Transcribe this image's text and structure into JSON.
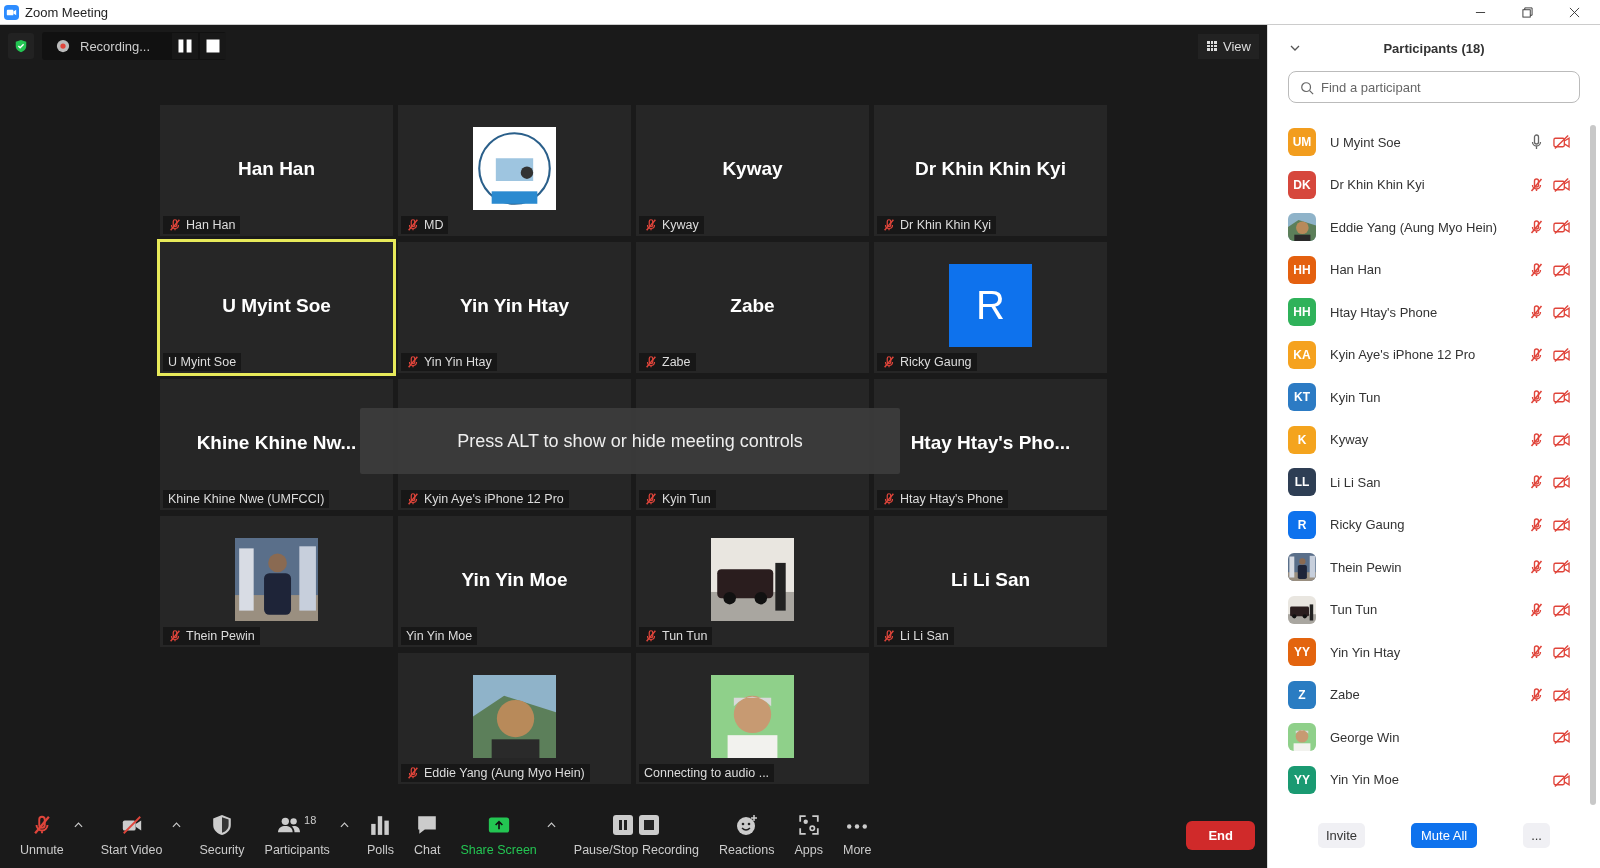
{
  "window": {
    "title": "Zoom Meeting"
  },
  "recording": {
    "label": "Recording..."
  },
  "view_button": {
    "label": "View"
  },
  "tiles": [
    {
      "kind": "name",
      "display_name": "Han Han",
      "label": "Han Han",
      "muted": true,
      "speaking": false
    },
    {
      "kind": "picture",
      "label": "MD",
      "muted": true,
      "speaking": false
    },
    {
      "kind": "name",
      "display_name": "Kyway",
      "label": "Kyway",
      "muted": true,
      "speaking": false
    },
    {
      "kind": "name",
      "display_name": "Dr Khin Khin Kyi",
      "label": "Dr Khin Khin Kyi",
      "muted": true,
      "speaking": false
    },
    {
      "kind": "name",
      "display_name": "U Myint Soe",
      "label": "U Myint Soe",
      "muted": false,
      "speaking": true
    },
    {
      "kind": "name",
      "display_name": "Yin Yin Htay",
      "label": "Yin Yin Htay",
      "muted": true,
      "speaking": false
    },
    {
      "kind": "name",
      "display_name": "Zabe",
      "label": "Zabe",
      "muted": true,
      "speaking": false
    },
    {
      "kind": "letter",
      "display_name": "R",
      "label": "Ricky Gaung",
      "muted": true,
      "speaking": false
    },
    {
      "kind": "name",
      "display_name": "Khine Khine Nw...",
      "label": "Khine Khine Nwe (UMFCCI)",
      "muted": false,
      "speaking": false
    },
    {
      "kind": "blank",
      "label": "Kyin Aye's iPhone 12 Pro",
      "muted": true,
      "speaking": false
    },
    {
      "kind": "blank",
      "label": "Kyin Tun",
      "muted": true,
      "speaking": false
    },
    {
      "kind": "name",
      "display_name": "Htay Htay's Pho...",
      "label": "Htay Htay's Phone",
      "muted": true,
      "speaking": false
    },
    {
      "kind": "picture",
      "label": "Thein Pewin",
      "muted": true,
      "speaking": false
    },
    {
      "kind": "name",
      "display_name": "Yin Yin Moe",
      "label": "Yin Yin Moe",
      "muted": false,
      "speaking": false
    },
    {
      "kind": "picture",
      "label": "Tun Tun",
      "muted": true,
      "speaking": false
    },
    {
      "kind": "name",
      "display_name": "Li Li San",
      "label": "Li Li San",
      "muted": true,
      "speaking": false
    },
    {
      "kind": "picture",
      "label": "Eddie Yang (Aung Myo Hein)",
      "muted": true,
      "speaking": false
    },
    {
      "kind": "picture",
      "label": "Connecting to audio ...",
      "muted": false,
      "speaking": false
    }
  ],
  "overlay": {
    "text": "Press ALT to show or hide meeting controls"
  },
  "toolbar": [
    {
      "kind": "mic",
      "label": "Unmute",
      "menu": true
    },
    {
      "kind": "video",
      "label": "Start Video",
      "menu": true
    },
    {
      "kind": "security",
      "label": "Security",
      "menu": false
    },
    {
      "kind": "participants",
      "label": "Participants",
      "count": "18",
      "menu": true
    },
    {
      "kind": "polls",
      "label": "Polls",
      "menu": false
    },
    {
      "kind": "chat",
      "label": "Chat",
      "menu": false
    },
    {
      "kind": "share",
      "label": "Share Screen",
      "menu": true
    },
    {
      "kind": "record",
      "label": "Pause/Stop Recording",
      "menu": false
    },
    {
      "kind": "reactions",
      "label": "Reactions",
      "menu": false
    },
    {
      "kind": "apps",
      "label": "Apps",
      "menu": false
    },
    {
      "kind": "more",
      "label": "More",
      "menu": false
    }
  ],
  "end_button": {
    "label": "End"
  },
  "panel": {
    "title": "Participants (18)",
    "search": {
      "placeholder": "Find a participant"
    },
    "participants": [
      {
        "name": "U Myint Soe",
        "avatar": "UM",
        "color": "#f29d1e",
        "audio_connected": true,
        "muted": false,
        "video_off": true
      },
      {
        "name": "Dr Khin Khin Kyi",
        "avatar": "DK",
        "color": "#d6473c",
        "audio_connected": true,
        "muted": true,
        "video_off": true
      },
      {
        "name": "Eddie Yang (Aung Myo Hein)",
        "kind": "picture",
        "audio_connected": true,
        "muted": true,
        "video_off": true
      },
      {
        "name": "Han Han",
        "avatar": "HH",
        "color": "#e4600f",
        "audio_connected": true,
        "muted": true,
        "video_off": true
      },
      {
        "name": "Htay Htay's Phone",
        "avatar": "HH",
        "color": "#2fb25a",
        "audio_connected": true,
        "muted": true,
        "video_off": true
      },
      {
        "name": "Kyin Aye's iPhone 12 Pro",
        "avatar": "KA",
        "color": "#f5a21f",
        "audio_connected": true,
        "muted": true,
        "video_off": true
      },
      {
        "name": "Kyin Tun",
        "avatar": "KT",
        "color": "#2c7bc4",
        "audio_connected": true,
        "muted": true,
        "video_off": true
      },
      {
        "name": "Kyway",
        "avatar": "K",
        "color": "#f4a41e",
        "audio_connected": true,
        "muted": true,
        "video_off": true
      },
      {
        "name": "Li Li San",
        "avatar": "LL",
        "color": "#2e3e54",
        "audio_connected": true,
        "muted": true,
        "video_off": true
      },
      {
        "name": "Ricky Gaung",
        "avatar": "R",
        "color": "#0e72ed",
        "audio_connected": true,
        "muted": true,
        "video_off": true
      },
      {
        "name": "Thein Pewin",
        "kind": "picture",
        "audio_connected": true,
        "muted": true,
        "video_off": true
      },
      {
        "name": "Tun Tun",
        "kind": "picture",
        "audio_connected": true,
        "muted": true,
        "video_off": true
      },
      {
        "name": "Yin Yin Htay",
        "avatar": "YY",
        "color": "#e3640e",
        "audio_connected": true,
        "muted": true,
        "video_off": true
      },
      {
        "name": "Zabe",
        "avatar": "Z",
        "color": "#2a7cc2",
        "audio_connected": true,
        "muted": true,
        "video_off": true
      },
      {
        "name": "George Win",
        "kind": "picture",
        "audio_connected": false,
        "video_off": true
      },
      {
        "name": "Yin Yin Moe",
        "avatar": "YY",
        "color": "#1a9a72",
        "audio_connected": false,
        "video_off": true
      }
    ],
    "buttons": [
      {
        "kind": "plain",
        "label": "Invite"
      },
      {
        "kind": "primary",
        "label": "Mute All"
      },
      {
        "kind": "plain",
        "label": "..."
      }
    ]
  }
}
